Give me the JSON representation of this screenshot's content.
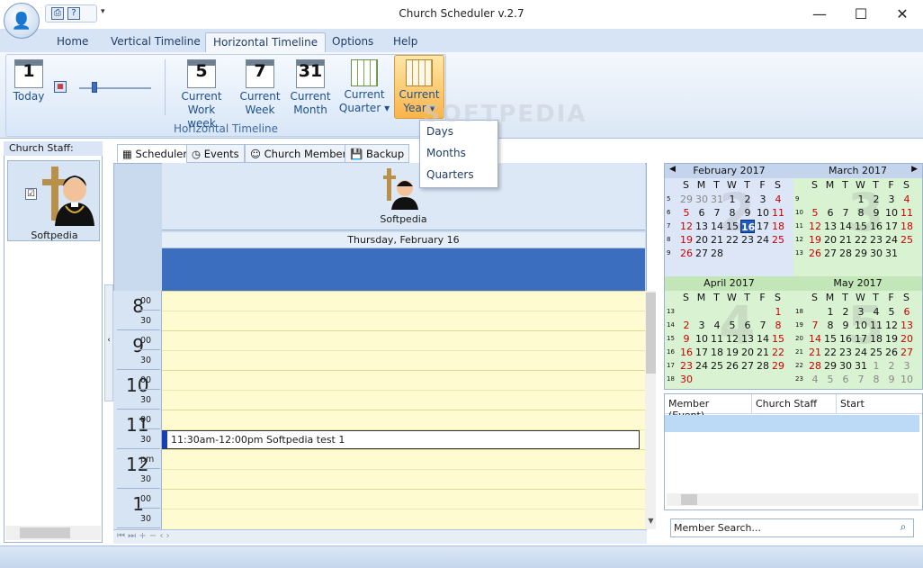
{
  "window": {
    "title": "Church Scheduler v.2.7",
    "min": "—",
    "max": "☐",
    "close": "✕"
  },
  "qat": {
    "print": "⎙",
    "help": "?",
    "more": "▾"
  },
  "tabs": [
    "Home",
    "Vertical Timeline",
    "Horizontal Timeline",
    "Options",
    "Help"
  ],
  "active_tab": "Horizontal Timeline",
  "ribbon": {
    "group_label": "Horizontal Timeline",
    "buttons": [
      {
        "id": "today",
        "icon_num": "1",
        "line1": "Today",
        "line2": ""
      },
      {
        "id": "workweek",
        "icon_num": "5",
        "line1": "Current",
        "line2": "Work week"
      },
      {
        "id": "week",
        "icon_num": "7",
        "line1": "Current",
        "line2": "Week"
      },
      {
        "id": "month",
        "icon_num": "31",
        "line1": "Current",
        "line2": "Month"
      },
      {
        "id": "quarter",
        "icon_num": "",
        "line1": "Current",
        "line2": "Quarter ▾"
      },
      {
        "id": "year",
        "icon_num": "",
        "line1": "Current",
        "line2": "Year ▾"
      }
    ],
    "zoom_level": 0.2
  },
  "dropdown": {
    "items": [
      "Days",
      "Months",
      "Quarters"
    ]
  },
  "watermark": "SOFTPEDIA",
  "staff": {
    "header": "Church Staff:",
    "member": "Softpedia",
    "checked": "☑"
  },
  "center_tabs": [
    "Scheduler",
    "Events",
    "Church Members",
    "Backup"
  ],
  "scheduler": {
    "resource": "Softpedia",
    "date": "Thursday, February 16",
    "times": [
      {
        "h": "8",
        "m": "00",
        "h2": "30"
      },
      {
        "h": "9",
        "m": "00",
        "h2": "30"
      },
      {
        "h": "10",
        "m": "00",
        "h2": "30"
      },
      {
        "h": "11",
        "m": "00",
        "h2": "30"
      },
      {
        "h": "12",
        "m": "pm",
        "h2": "30"
      },
      {
        "h": "1",
        "m": "00",
        "h2": "30"
      }
    ],
    "event": "11:30am-12:00pm Softpedia test 1",
    "nav": "⏮ ⏭ + − ‹                                                                                  ›"
  },
  "calendars": [
    {
      "name": "February 2017",
      "bg": "#dde6f6",
      "big": "2",
      "arrow_l": "◀",
      "arrow_r": "",
      "weeks": [
        "5",
        "6",
        "7",
        "8",
        "9"
      ],
      "days": [
        [
          "29",
          "30",
          "31",
          "1",
          "2",
          "3",
          "4"
        ],
        [
          "5",
          "6",
          "7",
          "8",
          "9",
          "10",
          "11"
        ],
        [
          "12",
          "13",
          "14",
          "15",
          "16",
          "17",
          "18"
        ],
        [
          "19",
          "20",
          "21",
          "22",
          "23",
          "24",
          "25"
        ],
        [
          "26",
          "27",
          "28",
          "",
          "",
          "",
          ""
        ]
      ],
      "today": "16"
    },
    {
      "name": "March 2017",
      "bg": "#d9f2d2",
      "big": "3",
      "arrow_l": "",
      "arrow_r": "▶",
      "weeks": [
        "9",
        "10",
        "11",
        "12",
        "13"
      ],
      "days": [
        [
          "",
          "",
          "",
          "1",
          "2",
          "3",
          "4"
        ],
        [
          "5",
          "6",
          "7",
          "8",
          "9",
          "10",
          "11"
        ],
        [
          "12",
          "13",
          "14",
          "15",
          "16",
          "17",
          "18"
        ],
        [
          "19",
          "20",
          "21",
          "22",
          "23",
          "24",
          "25"
        ],
        [
          "26",
          "27",
          "28",
          "29",
          "30",
          "31",
          ""
        ]
      ],
      "today": ""
    },
    {
      "name": "April 2017",
      "bg": "#d9f2d2",
      "big": "4",
      "arrow_l": "",
      "arrow_r": "",
      "weeks": [
        "13",
        "14",
        "15",
        "16",
        "17",
        "18"
      ],
      "days": [
        [
          "",
          "",
          "",
          "",
          "",
          "",
          "1"
        ],
        [
          "2",
          "3",
          "4",
          "5",
          "6",
          "7",
          "8"
        ],
        [
          "9",
          "10",
          "11",
          "12",
          "13",
          "14",
          "15"
        ],
        [
          "16",
          "17",
          "18",
          "19",
          "20",
          "21",
          "22"
        ],
        [
          "23",
          "24",
          "25",
          "26",
          "27",
          "28",
          "29"
        ],
        [
          "30",
          "",
          "",
          "",
          "",
          "",
          ""
        ]
      ],
      "today": ""
    },
    {
      "name": "May 2017",
      "bg": "#d9f2d2",
      "big": "5",
      "arrow_l": "",
      "arrow_r": "",
      "weeks": [
        "18",
        "19",
        "20",
        "21",
        "22",
        "23"
      ],
      "days": [
        [
          "",
          "1",
          "2",
          "3",
          "4",
          "5",
          "6"
        ],
        [
          "7",
          "8",
          "9",
          "10",
          "11",
          "12",
          "13"
        ],
        [
          "14",
          "15",
          "16",
          "17",
          "18",
          "19",
          "20"
        ],
        [
          "21",
          "22",
          "23",
          "24",
          "25",
          "26",
          "27"
        ],
        [
          "28",
          "29",
          "30",
          "31",
          "1",
          "2",
          "3"
        ],
        [
          "4",
          "5",
          "6",
          "7",
          "8",
          "9",
          "10"
        ]
      ],
      "today": ""
    }
  ],
  "weekdays": [
    "S",
    "M",
    "T",
    "W",
    "T",
    "F",
    "S"
  ],
  "list": {
    "columns": [
      "Member (Event)",
      "Church Staff",
      "Start"
    ]
  },
  "search": {
    "placeholder": "Member Search..."
  },
  "colors": {
    "accent": "#3b6ebf",
    "weekend": "#cc0000",
    "grid": "#fffbd1"
  }
}
